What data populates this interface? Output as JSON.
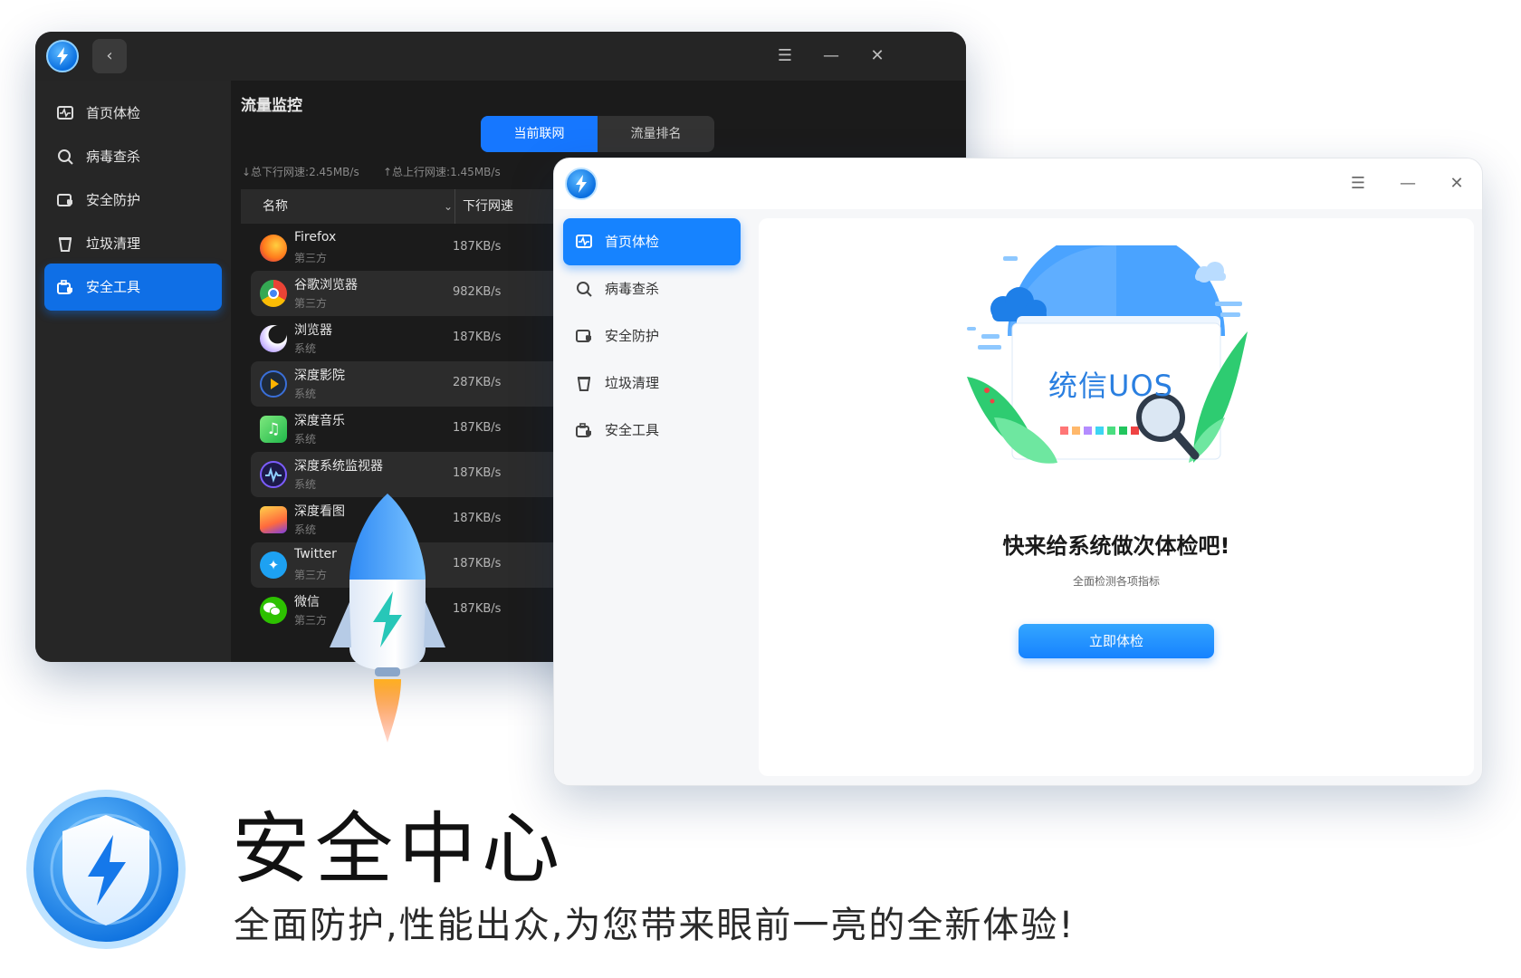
{
  "dark_window": {
    "sidebar": [
      {
        "label": "首页体检",
        "icon": "health-check-icon"
      },
      {
        "label": "病毒查杀",
        "icon": "virus-scan-icon"
      },
      {
        "label": "安全防护",
        "icon": "protection-icon"
      },
      {
        "label": "垃圾清理",
        "icon": "trash-clean-icon"
      },
      {
        "label": "安全工具",
        "icon": "tools-icon",
        "active": true
      }
    ],
    "title": "流量监控",
    "tabs": [
      {
        "label": "当前联网",
        "active": true
      },
      {
        "label": "流量排名",
        "active": false
      }
    ],
    "download_total": "↓总下行网速:2.45MB/s",
    "upload_total": "↑总上行网速:1.45MB/s",
    "columns": {
      "name": "名称",
      "download": "下行网速"
    },
    "rows": [
      {
        "name": "Firefox",
        "type": "第三方",
        "speed": "187KB/s",
        "icon": "firefox-icon"
      },
      {
        "name": "谷歌浏览器",
        "type": "第三方",
        "speed": "982KB/s",
        "icon": "chrome-icon"
      },
      {
        "name": "浏览器",
        "type": "系统",
        "speed": "187KB/s",
        "icon": "browser-icon"
      },
      {
        "name": "深度影院",
        "type": "系统",
        "speed": "287KB/s",
        "icon": "movie-icon"
      },
      {
        "name": "深度音乐",
        "type": "系统",
        "speed": "187KB/s",
        "icon": "music-icon"
      },
      {
        "name": "深度系统监视器",
        "type": "系统",
        "speed": "187KB/s",
        "icon": "system-monitor-icon"
      },
      {
        "name": "深度看图",
        "type": "系统",
        "speed": "187KB/s",
        "icon": "image-viewer-icon"
      },
      {
        "name": "Twitter",
        "type": "第三方",
        "speed": "187KB/s",
        "icon": "twitter-icon"
      },
      {
        "name": "微信",
        "type": "第三方",
        "speed": "187KB/s",
        "icon": "wechat-icon"
      }
    ]
  },
  "light_window": {
    "sidebar": [
      {
        "label": "首页体检",
        "active": true
      },
      {
        "label": "病毒查杀"
      },
      {
        "label": "安全防护"
      },
      {
        "label": "垃圾清理"
      },
      {
        "label": "安全工具"
      }
    ],
    "hero_text": "统信UOS",
    "headline": "快来给系统做次体检吧!",
    "subline": "全面检测各项指标",
    "button": "立即体检"
  },
  "brand": {
    "title": "安全中心",
    "subtitle": "全面防护,性能出众,为您带来眼前一亮的全新体验!"
  },
  "colors": {
    "accent": "#1683ff",
    "dark_bg": "#1f1f1f",
    "light_bg": "#f6f7f9"
  }
}
